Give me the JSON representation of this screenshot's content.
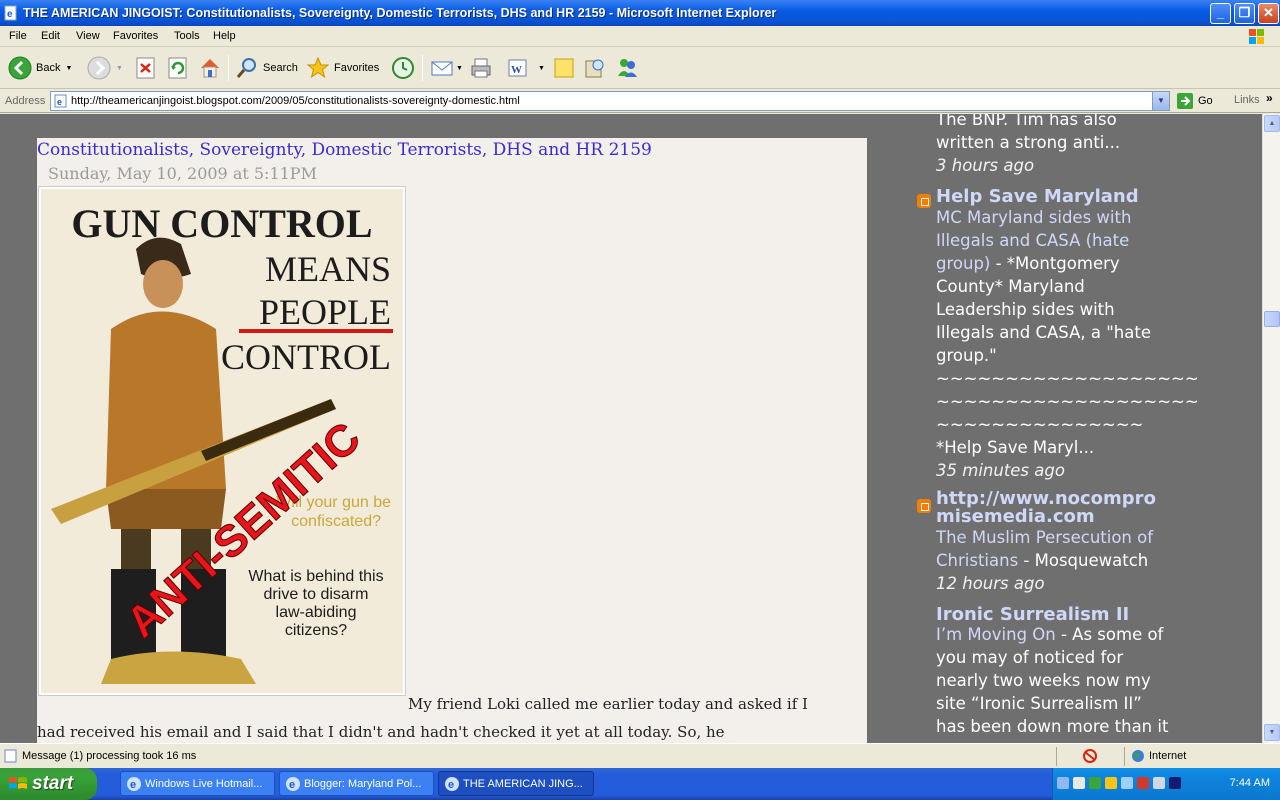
{
  "window": {
    "title": "THE AMERICAN JINGOIST: Constitutionalists, Sovereignty, Domestic Terrorists, DHS and HR 2159 - Microsoft Internet Explorer"
  },
  "menu": [
    "File",
    "Edit",
    "View",
    "Favorites",
    "Tools",
    "Help"
  ],
  "toolbar": {
    "back": "Back",
    "search": "Search",
    "favorites": "Favorites"
  },
  "address": {
    "label": "Address",
    "url": "http://theamericanjingoist.blogspot.com/2009/05/constitutionalists-sovereignty-domestic.html",
    "go": "Go",
    "links": "Links"
  },
  "post": {
    "title": "Constitutionalists, Sovereignty, Domestic Terrorists, DHS and HR 2159",
    "date": "Sunday, May 10, 2009 at 5:11PM",
    "poster": {
      "line1": "GUN CONTROL",
      "line2": "MEANS",
      "line3": "PEOPLE",
      "line4": "CONTROL",
      "q1a": "Will your gun be",
      "q1b": "confiscated?",
      "q2a": "What is behind this",
      "q2b": "drive to disarm",
      "q2c": "law-abiding",
      "q2d": "citizens?",
      "stamp": "ANTI-SEMITIC"
    },
    "body_line1": "My friend Loki called me earlier today and asked if I",
    "body_line2": "had received his email and I said that I didn't and hadn't checked it yet at all today. So, he"
  },
  "sidebar": {
    "entry0": {
      "text1": "The BNP. Tim has also",
      "text2": "written a strong anti...",
      "time": "3 hours ago"
    },
    "entry1": {
      "blog": "Help Save Maryland",
      "link1": "MC Maryland sides with",
      "link2": "Illegals and CASA (hate",
      "link3": "group)",
      "snip1": " - *Montgomery",
      "snip2": "County* Maryland",
      "snip3": "Leadership sides with",
      "snip4": "Illegals and CASA, a \"hate",
      "snip5": "group.\"",
      "tilde1": "~~~~~~~~~~~~~~~~~~~",
      "tilde2": "~~~~~~~~~~~~~~~~~~~",
      "tilde3": "~~~~~~~~~~~~~~~",
      "snip6": "*Help Save Maryl...",
      "time": "35 minutes ago"
    },
    "entry2": {
      "blog1": "http://www.nocompro",
      "blog2": "misemedia.com",
      "link1": "The Muslim Persecution of",
      "link2": "Christians",
      "snip1": " - Mosquewatch",
      "time": "12 hours ago"
    },
    "entry3": {
      "blog": "Ironic Surrealism II",
      "link1": "I’m Moving On",
      "snip1": " - As some of",
      "snip2": "you may of noticed for",
      "snip3": "nearly two weeks now my",
      "snip4": "site “Ironic Surrealism II”",
      "snip5": "has been down more than it"
    }
  },
  "status": {
    "message": "Message (1) processing took 16 ms",
    "zone": "Internet"
  },
  "taskbar": {
    "start": "start",
    "tasks": [
      "Windows Live Hotmail...",
      "Blogger: Maryland Pol...",
      "THE AMERICAN JING..."
    ],
    "clock": "7:44 AM"
  },
  "colors": {
    "link_blue": "#3b2bd0",
    "page_bg": "#6f6f6f",
    "post_bg": "#f3f0ec",
    "sidebar_link": "#cfd8f6",
    "blogger_orange": "#f57d00"
  }
}
